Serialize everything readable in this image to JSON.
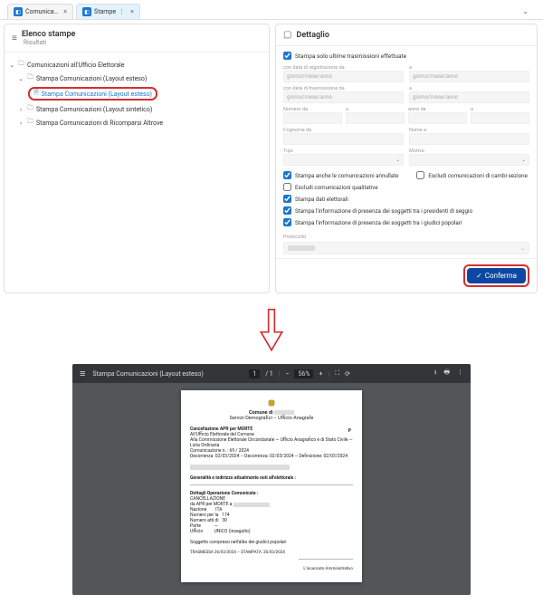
{
  "tabs": {
    "t1": "Comunica…",
    "t2": "Stampe"
  },
  "left": {
    "title": "Elenco stampe",
    "sub": "Risultati",
    "root": "Comunicazioni all'Ufficio Elettorale",
    "n1": "Stampa Comunicazioni (Layout esteso)",
    "n1s": "Stampa Comunicazioni (Layout esteso)",
    "n2": "Stampa Comunicazioni (Layout sintetico)",
    "n3": "Stampa Comunicazioni di Ricomparsi Altrove"
  },
  "detail": {
    "title": "Dettaglio",
    "chk_top": "Stampa solo ultime trasmissioni effettuate",
    "ph_date": "giorno/mese/anno",
    "lbl_reg": "con data di registrazione da",
    "lbl_a": "a",
    "lbl_tras": "con data di trasmissione da",
    "lbl_numda": "Numero da",
    "lbl_annoda": "anno da",
    "lbl_cogda": "Cognome da",
    "lbl_nomea": "Nome a",
    "lbl_tipo": "Tipo",
    "lbl_motivo": "Motivo",
    "c1": "Stampa anche le comunicazioni annullate",
    "c2": "Escludi comunicazioni di cambi sezione",
    "c3": "Escludi comunicazioni qualitative",
    "c4": "Stampa dati elettorali",
    "c5": "Stampa l'informazione di presenza dei soggetti tra i presidenti di seggio",
    "c6": "Stampa l'informazione di presenza dei soggetti tra i giudici popolari",
    "prog": "Protocollo",
    "confirm": "Conferma"
  },
  "viewer": {
    "title": "Stampa Comunicazioni (Layout esteso)",
    "page": "1",
    "pages": "/ 1",
    "zoom": "56%"
  },
  "doc": {
    "comune": "Comune di",
    "servizi": "Servizi Demografici – Ufficio Anagrafe",
    "canc_title": "Cancellazione APR per MORTE",
    "line1": "All'Ufficio Elettorale del Comune",
    "line2": "Alla Commissione Elettorale Circondariale — Ufficio Anagrafico e di Stato Civile — Lista Ordinaria",
    "line3": "Comunicazione n. : 69 / 2024",
    "line4": "Decorrenza: 02/03/2024 – Decorrenza: 02/03/2024 – Definizione: 02/03/2024",
    "sub1": "Generalità e indirizzo attualmente noti all'elettorale :",
    "sub2": "Dettagli Operazione Comunicata :",
    "d1": "CANCELLAZIONE",
    "d2": "da APR per MORTE a",
    "d3l": "Nazione",
    "d3v": "ITA",
    "d4l": "Numero per la",
    "d4v": "174",
    "d5l": "Numero atti di",
    "d5v": "30",
    "d6l": "Parte",
    "d6v": "—",
    "d7l": "Ufficio",
    "d7v": "UNICO (inseguito)",
    "note": "Soggetto compreso nell'albo dei giudici popolari",
    "foot": "TRASMESSA 26/03/2024 – STAMPATA: 26/03/2024",
    "sig": "L'incaricato Amministrativo"
  }
}
